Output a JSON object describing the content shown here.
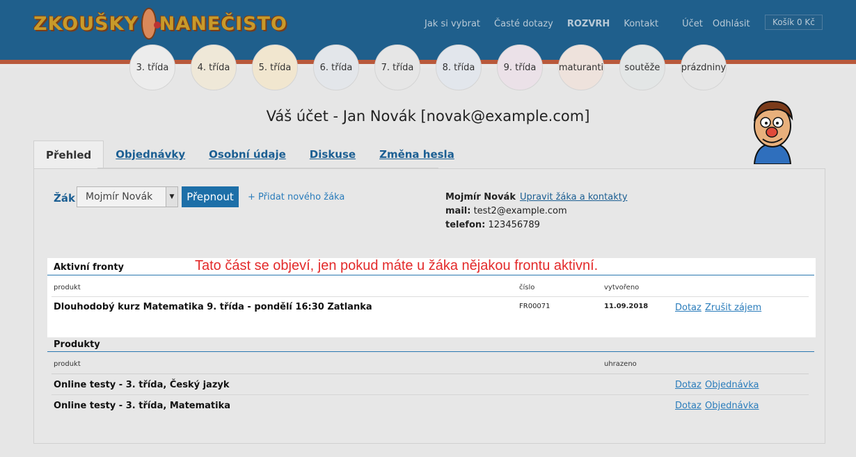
{
  "header": {
    "logo_text_left": "ZKOUŠKY",
    "logo_text_right": "NANEČISTO",
    "nav": [
      "Jak si vybrat",
      "Časté dotazy",
      "ROZVRH",
      "Kontakt"
    ],
    "account": "Účet",
    "logout": "Odhlásit",
    "cart": "Košík 0 Kč",
    "colors": {
      "bar": "#1f5f8c",
      "stripe": "#b9593b"
    }
  },
  "grades": [
    "3. třída",
    "4. třída",
    "5. třída",
    "6. třída",
    "7. třída",
    "8. třída",
    "9. třída",
    "maturanti",
    "soutěže",
    "prázdniny"
  ],
  "page": {
    "title": "Váš účet - Jan Novák [novak@example.com]"
  },
  "tabs": [
    "Přehled",
    "Objednávky",
    "Osobní údaje",
    "Diskuse",
    "Změna hesla"
  ],
  "student_switch": {
    "label": "Žák",
    "selected": "Mojmír Novák",
    "switch_button": "Přepnout",
    "add_student": "+ Přidat nového žáka"
  },
  "student_info": {
    "name": "Mojmír Novák",
    "edit_link": "Upravit žáka a kontakty",
    "mail_label": "mail:",
    "mail": "test2@example.com",
    "phone_label": "telefon:",
    "phone": "123456789"
  },
  "notice": "Tato část se objeví, jen pokud máte u žáka nějakou frontu aktivní.",
  "active_queues": {
    "heading": "Aktivní fronty",
    "columns": {
      "product": "produkt",
      "number": "číslo",
      "created": "vytvořeno"
    },
    "rows": [
      {
        "product": "Dlouhodobý kurz Matematika 9. třída - pondělí 16:30 Zatlanka",
        "number": "FR00071",
        "created": "11.09.2018",
        "link1": "Dotaz",
        "link2": "Zrušit zájem"
      }
    ]
  },
  "products": {
    "heading": "Produkty",
    "columns": {
      "product": "produkt",
      "paid": "uhrazeno"
    },
    "rows": [
      {
        "product": "Online testy - 3. třída, Český jazyk",
        "link1": "Dotaz",
        "link2": "Objednávka"
      },
      {
        "product": "Online testy - 3. třída, Matematika",
        "link1": "Dotaz",
        "link2": "Objednávka"
      }
    ]
  }
}
